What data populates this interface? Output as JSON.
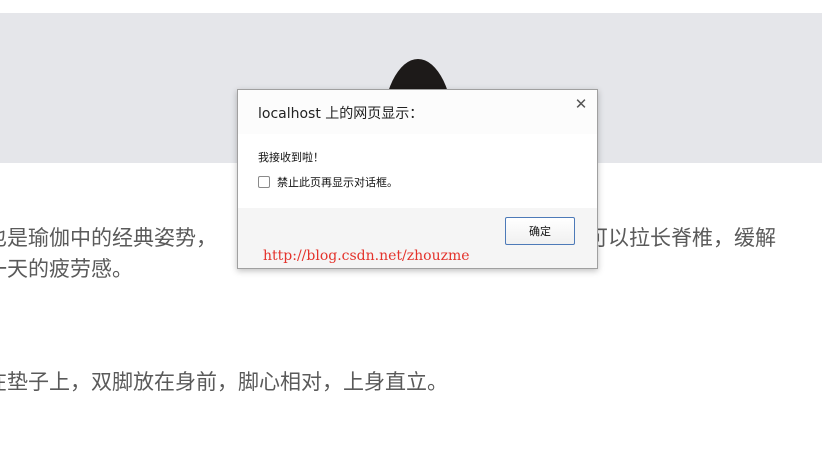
{
  "article": {
    "line1_left": "也是瑜伽中的经典姿势，",
    "line1_right": "还可以拉长脊椎，缓解",
    "line2": "一天的疲劳感。",
    "line3": "在垫子上，双脚放在身前，脚心相对，上身直立。"
  },
  "dialog": {
    "title": "localhost 上的网页显示：",
    "close_icon": "close-icon",
    "message": "我接收到啦！",
    "suppress_label": "禁止此页再显示对话框。",
    "suppress_checked": false,
    "ok_label": "确定"
  },
  "watermark": {
    "text": "http://blog.csdn.net/zhouzme"
  },
  "colors": {
    "hero_band": "#e5e6ea",
    "article_text": "#5a5a5a",
    "watermark": "#e4332c",
    "ok_border": "#4d7ab8"
  }
}
